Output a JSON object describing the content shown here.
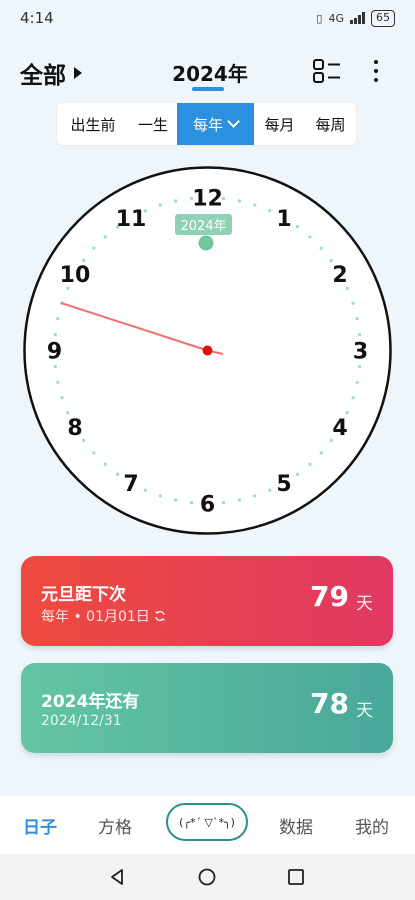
{
  "status": {
    "time": "4:14",
    "network": "4G",
    "battery": "65"
  },
  "header": {
    "category": "全部",
    "title": "2024年"
  },
  "filter": {
    "items": [
      "出生前",
      "一生",
      "每年",
      "每月",
      "每周"
    ],
    "active_index": 2
  },
  "clock": {
    "numbers": [
      "1",
      "2",
      "3",
      "4",
      "5",
      "6",
      "7",
      "8",
      "9",
      "10",
      "11",
      "12"
    ],
    "badge": "2024年",
    "hand_position_hours": 9.6
  },
  "cards": [
    {
      "title": "元旦距下次",
      "subtitle": "每年 • 01月01日",
      "value": "79",
      "unit": "天"
    },
    {
      "title": "2024年还有",
      "subtitle": "2024/12/31",
      "value": "78",
      "unit": "天"
    }
  ],
  "nav": {
    "items": [
      "日子",
      "方格",
      "数据",
      "我的"
    ],
    "emoticon": "(╭*´ ▽`*╮)",
    "active_index": 0
  },
  "colors": {
    "accent": "#2d8fe0",
    "card_red": "#ef4a3e",
    "card_green": "#5bbfa0",
    "hand": "#f07070",
    "center_dot": "#e01010",
    "badge": "#8fd1b5"
  }
}
